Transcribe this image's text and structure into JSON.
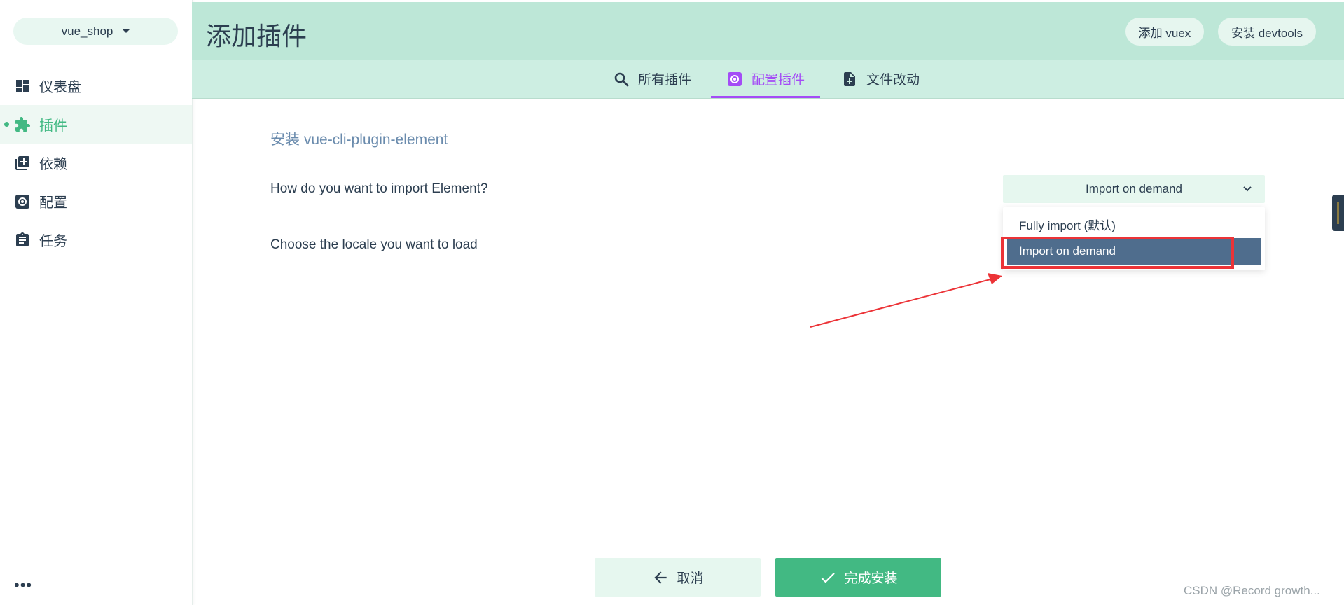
{
  "sidebar": {
    "project": "vue_shop",
    "items": [
      {
        "label": "仪表盘",
        "icon": "dashboard-icon"
      },
      {
        "label": "插件",
        "icon": "puzzle-icon",
        "active": true
      },
      {
        "label": "依赖",
        "icon": "library-icon"
      },
      {
        "label": "配置",
        "icon": "gear-icon"
      },
      {
        "label": "任务",
        "icon": "clipboard-icon"
      }
    ],
    "more": "•••"
  },
  "header": {
    "title": "添加插件",
    "add_vuex": "添加 vuex",
    "install_devtools": "安装 devtools"
  },
  "tabs": [
    {
      "label": "所有插件",
      "icon": "search-icon"
    },
    {
      "label": "配置插件",
      "icon": "gear-icon",
      "active": true
    },
    {
      "label": "文件改动",
      "icon": "file-add-icon"
    }
  ],
  "main": {
    "title": "安装 vue-cli-plugin-element",
    "question_import": "How do you want to import Element?",
    "question_locale": "Choose the locale you want to load",
    "select_value": "Import on demand",
    "options": [
      "Fully import (默认)",
      "Import on demand"
    ]
  },
  "footer": {
    "cancel": "取消",
    "finish": "完成安装"
  },
  "watermark": "CSDN @Record growth...",
  "colors": {
    "accent": "#42b983",
    "tab_active": "#a44cf6",
    "header_bg": "#bde7d7",
    "annotation": "#ec3337"
  }
}
